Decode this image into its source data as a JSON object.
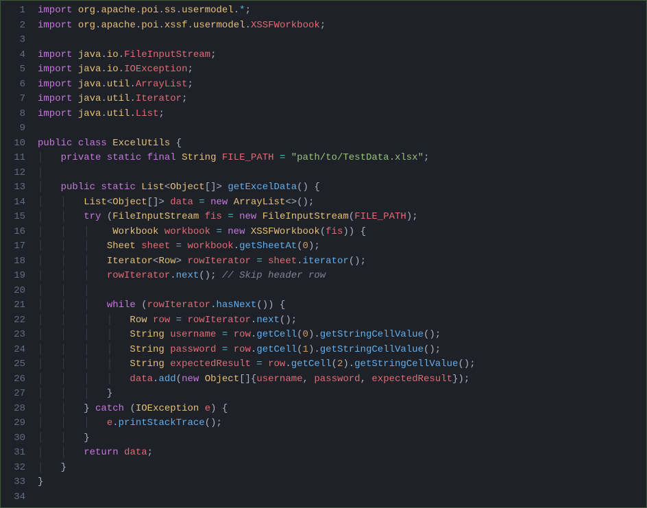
{
  "lines": [
    {
      "n": 1,
      "tokens": [
        [
          "kw",
          "import"
        ],
        [
          "pun",
          " "
        ],
        [
          "pkg",
          "org"
        ],
        [
          "dot",
          "."
        ],
        [
          "pkg",
          "apache"
        ],
        [
          "dot",
          "."
        ],
        [
          "pkg",
          "poi"
        ],
        [
          "dot",
          "."
        ],
        [
          "pkg",
          "ss"
        ],
        [
          "dot",
          "."
        ],
        [
          "pkg",
          "usermodel"
        ],
        [
          "dot",
          "."
        ],
        [
          "op",
          "*"
        ],
        [
          "pun",
          ";"
        ]
      ]
    },
    {
      "n": 2,
      "tokens": [
        [
          "kw",
          "import"
        ],
        [
          "pun",
          " "
        ],
        [
          "pkg",
          "org"
        ],
        [
          "dot",
          "."
        ],
        [
          "pkg",
          "apache"
        ],
        [
          "dot",
          "."
        ],
        [
          "pkg",
          "poi"
        ],
        [
          "dot",
          "."
        ],
        [
          "pkg",
          "xssf"
        ],
        [
          "dot",
          "."
        ],
        [
          "pkg",
          "usermodel"
        ],
        [
          "dot",
          "."
        ],
        [
          "pkgr",
          "XSSFWorkbook"
        ],
        [
          "pun",
          ";"
        ]
      ]
    },
    {
      "n": 3,
      "tokens": []
    },
    {
      "n": 4,
      "tokens": [
        [
          "kw",
          "import"
        ],
        [
          "pun",
          " "
        ],
        [
          "pkg",
          "java"
        ],
        [
          "dot",
          "."
        ],
        [
          "pkg",
          "io"
        ],
        [
          "dot",
          "."
        ],
        [
          "pkgr",
          "FileInputStream"
        ],
        [
          "pun",
          ";"
        ]
      ]
    },
    {
      "n": 5,
      "tokens": [
        [
          "kw",
          "import"
        ],
        [
          "pun",
          " "
        ],
        [
          "pkg",
          "java"
        ],
        [
          "dot",
          "."
        ],
        [
          "pkg",
          "io"
        ],
        [
          "dot",
          "."
        ],
        [
          "pkgr",
          "IOException"
        ],
        [
          "pun",
          ";"
        ]
      ]
    },
    {
      "n": 6,
      "tokens": [
        [
          "kw",
          "import"
        ],
        [
          "pun",
          " "
        ],
        [
          "pkg",
          "java"
        ],
        [
          "dot",
          "."
        ],
        [
          "pkg",
          "util"
        ],
        [
          "dot",
          "."
        ],
        [
          "pkgr",
          "ArrayList"
        ],
        [
          "pun",
          ";"
        ]
      ]
    },
    {
      "n": 7,
      "tokens": [
        [
          "kw",
          "import"
        ],
        [
          "pun",
          " "
        ],
        [
          "pkg",
          "java"
        ],
        [
          "dot",
          "."
        ],
        [
          "pkg",
          "util"
        ],
        [
          "dot",
          "."
        ],
        [
          "pkgr",
          "Iterator"
        ],
        [
          "pun",
          ";"
        ]
      ]
    },
    {
      "n": 8,
      "tokens": [
        [
          "kw",
          "import"
        ],
        [
          "pun",
          " "
        ],
        [
          "pkg",
          "java"
        ],
        [
          "dot",
          "."
        ],
        [
          "pkg",
          "util"
        ],
        [
          "dot",
          "."
        ],
        [
          "pkgr",
          "List"
        ],
        [
          "pun",
          ";"
        ]
      ]
    },
    {
      "n": 9,
      "tokens": []
    },
    {
      "n": 10,
      "tokens": [
        [
          "kw",
          "public"
        ],
        [
          "pun",
          " "
        ],
        [
          "kw",
          "class"
        ],
        [
          "pun",
          " "
        ],
        [
          "type",
          "ExcelUtils"
        ],
        [
          "pun",
          " {"
        ]
      ]
    },
    {
      "n": 11,
      "tokens": [
        [
          "guide",
          "│   "
        ],
        [
          "kw",
          "private"
        ],
        [
          "pun",
          " "
        ],
        [
          "kw",
          "static"
        ],
        [
          "pun",
          " "
        ],
        [
          "kw",
          "final"
        ],
        [
          "pun",
          " "
        ],
        [
          "type",
          "String"
        ],
        [
          "pun",
          " "
        ],
        [
          "const",
          "FILE_PATH"
        ],
        [
          "pun",
          " "
        ],
        [
          "op",
          "="
        ],
        [
          "pun",
          " "
        ],
        [
          "str",
          "\"path/to/TestData.xlsx\""
        ],
        [
          "pun",
          ";"
        ]
      ]
    },
    {
      "n": 12,
      "tokens": [
        [
          "guide",
          "│"
        ]
      ]
    },
    {
      "n": 13,
      "tokens": [
        [
          "guide",
          "│   "
        ],
        [
          "kw",
          "public"
        ],
        [
          "pun",
          " "
        ],
        [
          "kw",
          "static"
        ],
        [
          "pun",
          " "
        ],
        [
          "type",
          "List"
        ],
        [
          "pun",
          "<"
        ],
        [
          "type",
          "Object"
        ],
        [
          "pun",
          "[]> "
        ],
        [
          "fn",
          "getExcelData"
        ],
        [
          "pun",
          "() {"
        ]
      ]
    },
    {
      "n": 14,
      "tokens": [
        [
          "guide",
          "│   │   "
        ],
        [
          "type",
          "List"
        ],
        [
          "pun",
          "<"
        ],
        [
          "type",
          "Object"
        ],
        [
          "pun",
          "[]> "
        ],
        [
          "var",
          "data"
        ],
        [
          "pun",
          " "
        ],
        [
          "op",
          "="
        ],
        [
          "pun",
          " "
        ],
        [
          "kw",
          "new"
        ],
        [
          "pun",
          " "
        ],
        [
          "type",
          "ArrayList"
        ],
        [
          "pun",
          "<>();"
        ]
      ]
    },
    {
      "n": 15,
      "tokens": [
        [
          "guide",
          "│   │   "
        ],
        [
          "kw",
          "try"
        ],
        [
          "pun",
          " ("
        ],
        [
          "type",
          "FileInputStream"
        ],
        [
          "pun",
          " "
        ],
        [
          "var",
          "fis"
        ],
        [
          "pun",
          " "
        ],
        [
          "op",
          "="
        ],
        [
          "pun",
          " "
        ],
        [
          "kw",
          "new"
        ],
        [
          "pun",
          " "
        ],
        [
          "type",
          "FileInputStream"
        ],
        [
          "pun",
          "("
        ],
        [
          "const",
          "FILE_PATH"
        ],
        [
          "pun",
          ");"
        ]
      ]
    },
    {
      "n": 16,
      "tokens": [
        [
          "guide",
          "│   │   │    "
        ],
        [
          "type",
          "Workbook"
        ],
        [
          "pun",
          " "
        ],
        [
          "var",
          "workbook"
        ],
        [
          "pun",
          " "
        ],
        [
          "op",
          "="
        ],
        [
          "pun",
          " "
        ],
        [
          "kw",
          "new"
        ],
        [
          "pun",
          " "
        ],
        [
          "type",
          "XSSFWorkbook"
        ],
        [
          "pun",
          "("
        ],
        [
          "var",
          "fis"
        ],
        [
          "pun",
          ")) {"
        ]
      ]
    },
    {
      "n": 17,
      "tokens": [
        [
          "guide",
          "│   │   │   "
        ],
        [
          "type",
          "Sheet"
        ],
        [
          "pun",
          " "
        ],
        [
          "var",
          "sheet"
        ],
        [
          "pun",
          " "
        ],
        [
          "op",
          "="
        ],
        [
          "pun",
          " "
        ],
        [
          "var",
          "workbook"
        ],
        [
          "dot",
          "."
        ],
        [
          "fn",
          "getSheetAt"
        ],
        [
          "pun",
          "("
        ],
        [
          "num",
          "0"
        ],
        [
          "pun",
          ");"
        ]
      ]
    },
    {
      "n": 18,
      "tokens": [
        [
          "guide",
          "│   │   │   "
        ],
        [
          "type",
          "Iterator"
        ],
        [
          "pun",
          "<"
        ],
        [
          "type",
          "Row"
        ],
        [
          "pun",
          "> "
        ],
        [
          "var",
          "rowIterator"
        ],
        [
          "pun",
          " "
        ],
        [
          "op",
          "="
        ],
        [
          "pun",
          " "
        ],
        [
          "var",
          "sheet"
        ],
        [
          "dot",
          "."
        ],
        [
          "fn",
          "iterator"
        ],
        [
          "pun",
          "();"
        ]
      ]
    },
    {
      "n": 19,
      "tokens": [
        [
          "guide",
          "│   │   │   "
        ],
        [
          "var",
          "rowIterator"
        ],
        [
          "dot",
          "."
        ],
        [
          "fn",
          "next"
        ],
        [
          "pun",
          "(); "
        ],
        [
          "cmt",
          "// Skip header row"
        ]
      ]
    },
    {
      "n": 20,
      "tokens": [
        [
          "guide",
          "│   │   │"
        ]
      ]
    },
    {
      "n": 21,
      "tokens": [
        [
          "guide",
          "│   │   │   "
        ],
        [
          "kw",
          "while"
        ],
        [
          "pun",
          " ("
        ],
        [
          "var",
          "rowIterator"
        ],
        [
          "dot",
          "."
        ],
        [
          "fn",
          "hasNext"
        ],
        [
          "pun",
          "()) {"
        ]
      ]
    },
    {
      "n": 22,
      "tokens": [
        [
          "guide",
          "│   │   │   │   "
        ],
        [
          "type",
          "Row"
        ],
        [
          "pun",
          " "
        ],
        [
          "var",
          "row"
        ],
        [
          "pun",
          " "
        ],
        [
          "op",
          "="
        ],
        [
          "pun",
          " "
        ],
        [
          "var",
          "rowIterator"
        ],
        [
          "dot",
          "."
        ],
        [
          "fn",
          "next"
        ],
        [
          "pun",
          "();"
        ]
      ]
    },
    {
      "n": 23,
      "tokens": [
        [
          "guide",
          "│   │   │   │   "
        ],
        [
          "type",
          "String"
        ],
        [
          "pun",
          " "
        ],
        [
          "var",
          "username"
        ],
        [
          "pun",
          " "
        ],
        [
          "op",
          "="
        ],
        [
          "pun",
          " "
        ],
        [
          "var",
          "row"
        ],
        [
          "dot",
          "."
        ],
        [
          "fn",
          "getCell"
        ],
        [
          "pun",
          "("
        ],
        [
          "num",
          "0"
        ],
        [
          "pun",
          ")"
        ],
        [
          "dot",
          "."
        ],
        [
          "fn",
          "getStringCellValue"
        ],
        [
          "pun",
          "();"
        ]
      ]
    },
    {
      "n": 24,
      "tokens": [
        [
          "guide",
          "│   │   │   │   "
        ],
        [
          "type",
          "String"
        ],
        [
          "pun",
          " "
        ],
        [
          "var",
          "password"
        ],
        [
          "pun",
          " "
        ],
        [
          "op",
          "="
        ],
        [
          "pun",
          " "
        ],
        [
          "var",
          "row"
        ],
        [
          "dot",
          "."
        ],
        [
          "fn",
          "getCell"
        ],
        [
          "pun",
          "("
        ],
        [
          "num",
          "1"
        ],
        [
          "pun",
          ")"
        ],
        [
          "dot",
          "."
        ],
        [
          "fn",
          "getStringCellValue"
        ],
        [
          "pun",
          "();"
        ]
      ]
    },
    {
      "n": 25,
      "tokens": [
        [
          "guide",
          "│   │   │   │   "
        ],
        [
          "type",
          "String"
        ],
        [
          "pun",
          " "
        ],
        [
          "var",
          "expectedResult"
        ],
        [
          "pun",
          " "
        ],
        [
          "op",
          "="
        ],
        [
          "pun",
          " "
        ],
        [
          "var",
          "row"
        ],
        [
          "dot",
          "."
        ],
        [
          "fn",
          "getCell"
        ],
        [
          "pun",
          "("
        ],
        [
          "num",
          "2"
        ],
        [
          "pun",
          ")"
        ],
        [
          "dot",
          "."
        ],
        [
          "fn",
          "getStringCellValue"
        ],
        [
          "pun",
          "();"
        ]
      ]
    },
    {
      "n": 26,
      "tokens": [
        [
          "guide",
          "│   │   │   │   "
        ],
        [
          "var",
          "data"
        ],
        [
          "dot",
          "."
        ],
        [
          "fn",
          "add"
        ],
        [
          "pun",
          "("
        ],
        [
          "kw",
          "new"
        ],
        [
          "pun",
          " "
        ],
        [
          "type",
          "Object"
        ],
        [
          "pun",
          "[]{"
        ],
        [
          "var",
          "username"
        ],
        [
          "pun",
          ", "
        ],
        [
          "var",
          "password"
        ],
        [
          "pun",
          ", "
        ],
        [
          "var",
          "expectedResult"
        ],
        [
          "pun",
          "});"
        ]
      ]
    },
    {
      "n": 27,
      "tokens": [
        [
          "guide",
          "│   │   │   "
        ],
        [
          "pun",
          "}"
        ]
      ]
    },
    {
      "n": 28,
      "tokens": [
        [
          "guide",
          "│   │   "
        ],
        [
          "pun",
          "} "
        ],
        [
          "kw",
          "catch"
        ],
        [
          "pun",
          " ("
        ],
        [
          "type",
          "IOException"
        ],
        [
          "pun",
          " "
        ],
        [
          "var",
          "e"
        ],
        [
          "pun",
          ") {"
        ]
      ]
    },
    {
      "n": 29,
      "tokens": [
        [
          "guide",
          "│   │   │   "
        ],
        [
          "var",
          "e"
        ],
        [
          "dot",
          "."
        ],
        [
          "fn",
          "printStackTrace"
        ],
        [
          "pun",
          "();"
        ]
      ]
    },
    {
      "n": 30,
      "tokens": [
        [
          "guide",
          "│   │   "
        ],
        [
          "pun",
          "}"
        ]
      ]
    },
    {
      "n": 31,
      "tokens": [
        [
          "guide",
          "│   │   "
        ],
        [
          "kw",
          "return"
        ],
        [
          "pun",
          " "
        ],
        [
          "var",
          "data"
        ],
        [
          "pun",
          ";"
        ]
      ]
    },
    {
      "n": 32,
      "tokens": [
        [
          "guide",
          "│   "
        ],
        [
          "pun",
          "}"
        ]
      ]
    },
    {
      "n": 33,
      "tokens": [
        [
          "pun",
          "}"
        ]
      ]
    },
    {
      "n": 34,
      "tokens": []
    }
  ]
}
